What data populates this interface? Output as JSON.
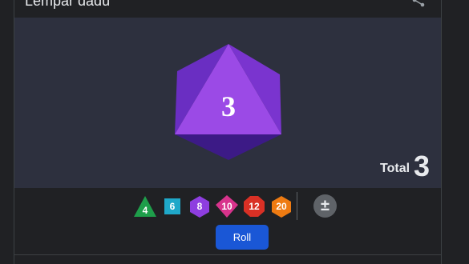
{
  "card": {
    "title": "Lempar dadu"
  },
  "die": {
    "value": "3",
    "colors": {
      "top": "#9b4ae6",
      "left": "#6a2ec2",
      "right": "#7a34cf",
      "bottom": "#3c1a86"
    }
  },
  "total": {
    "label": "Total",
    "value": "3"
  },
  "dice_options": [
    {
      "label": "4",
      "shape": "triangle",
      "color": "#1e9e4a"
    },
    {
      "label": "6",
      "shape": "square",
      "color": "#1fa8c9"
    },
    {
      "label": "8",
      "shape": "hexagon",
      "color": "#8e3ee0"
    },
    {
      "label": "10",
      "shape": "diamond",
      "color": "#d8338c"
    },
    {
      "label": "12",
      "shape": "octagon",
      "color": "#d93025"
    },
    {
      "label": "20",
      "shape": "hexagon",
      "color": "#ee7b12"
    }
  ],
  "modifier": {
    "label": "±"
  },
  "roll_button": {
    "label": "Roll"
  },
  "icons": {
    "share": "share-icon"
  }
}
